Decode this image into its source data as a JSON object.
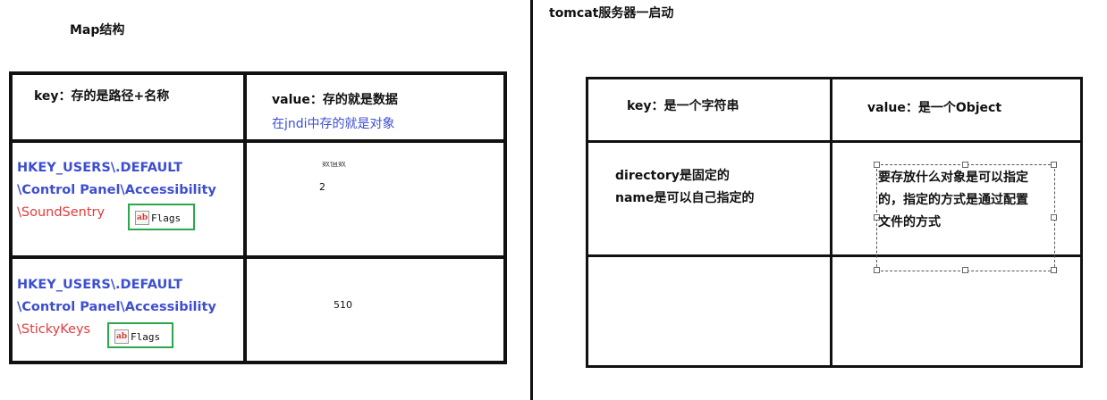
{
  "left": {
    "title": "Map结构",
    "header_key": "key：存的是路径+名称",
    "header_value": "value：存的就是数据",
    "header_value_note": "在jndi中存的就是对象",
    "rows": [
      {
        "path_line1": "HKEY_USERS\\.DEFAULT",
        "path_line2": "\\Control Panel\\Accessibility",
        "path_line3": "\\SoundSentry",
        "flags_label": "Flags",
        "value_label": "数值数",
        "value": "2"
      },
      {
        "path_line1": "HKEY_USERS\\.DEFAULT",
        "path_line2": "\\Control Panel\\Accessibility",
        "path_line3": "\\StickyKeys",
        "flags_label": "Flags",
        "value": "510"
      }
    ]
  },
  "right": {
    "title": "tomcat服务器一启动",
    "header_key": "key：是一个字符串",
    "header_value": "value：是一个Object",
    "row_key_line1": "directory是固定的",
    "row_key_line2": "name是可以自己指定的",
    "row_value_line1": "要存放什么对象是可以指定",
    "row_value_line2": "的，指定的方式是通过配置",
    "row_value_line3": "文件的方式"
  },
  "colors": {
    "blue_text": "#3d4fd0",
    "red_text": "#e23b3b",
    "flags_border": "#2aa84a"
  }
}
